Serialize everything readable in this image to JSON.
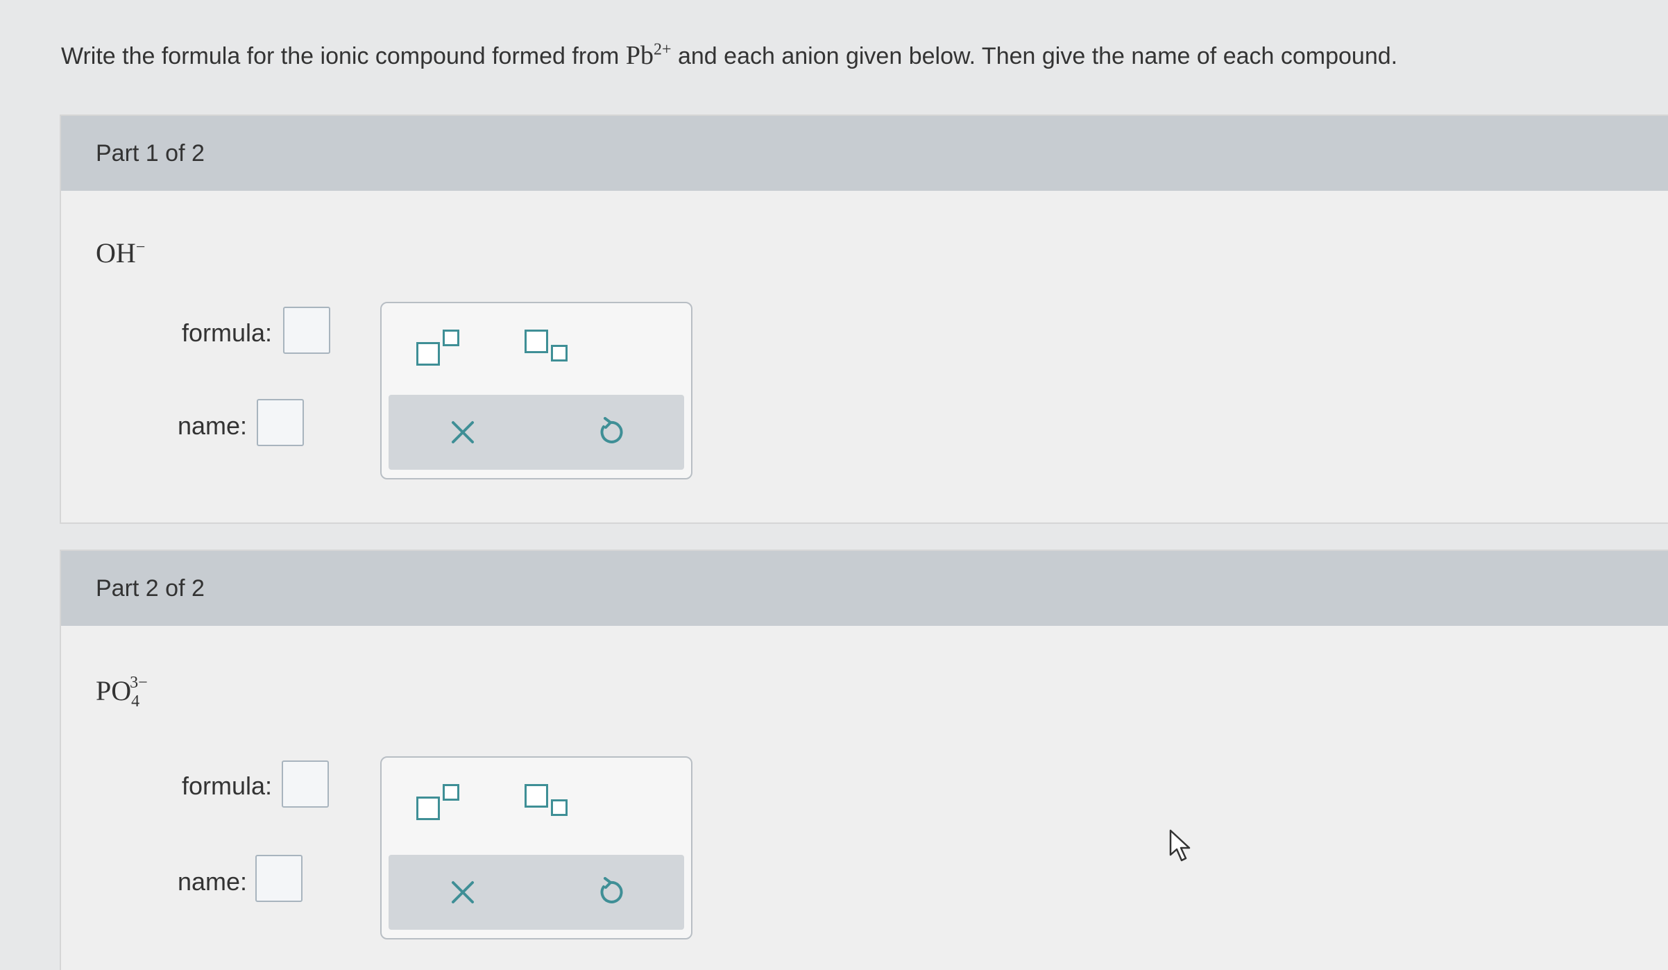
{
  "instruction": {
    "before": "Write the formula for the ionic compound formed from",
    "cation_symbol": "Pb",
    "cation_charge": "2+",
    "after": "and each anion given below. Then give the name of each compound."
  },
  "parts": [
    {
      "header": "Part 1 of 2",
      "anion_symbol": "OH",
      "anion_subscript": "",
      "anion_charge": "−",
      "formula_label": "formula:",
      "name_label": "name:"
    },
    {
      "header": "Part 2 of 2",
      "anion_symbol": "PO",
      "anion_subscript": "4",
      "anion_charge": "3−",
      "formula_label": "formula:",
      "name_label": "name:"
    }
  ],
  "icons": {
    "superscript": "superscript-template-icon",
    "subscript": "subscript-template-icon",
    "clear": "x-icon",
    "undo": "undo-icon"
  },
  "colors": {
    "accent": "#3f8f96",
    "header_bg": "#c7ccd1",
    "panel_bg": "#efefef",
    "page_bg": "#e7e8e9"
  }
}
